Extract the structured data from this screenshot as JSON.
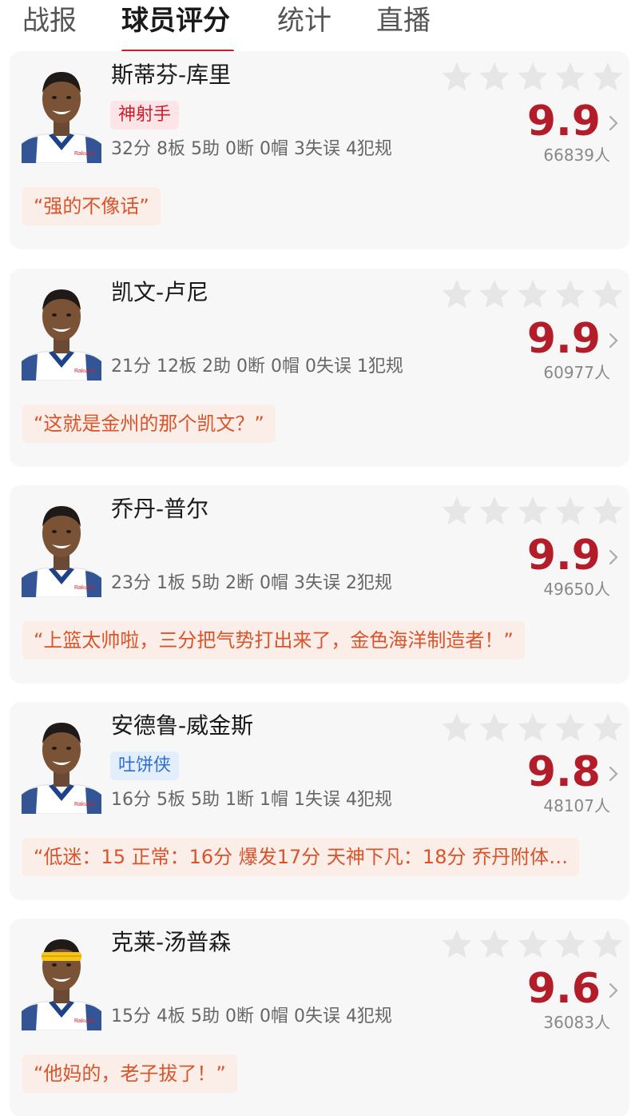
{
  "tabs": [
    {
      "label": "战报"
    },
    {
      "label": "球员评分"
    },
    {
      "label": "统计"
    },
    {
      "label": "直播"
    }
  ],
  "active_tab": "球员评分",
  "colors": {
    "accent": "#c8202d",
    "score": "#b31d2a",
    "quote_text": "#d8542b",
    "quote_bg": "#fbeee9",
    "star_empty": "#e6e6e6"
  },
  "players": [
    {
      "name": "斯蒂芬-库里",
      "badge": "神射手",
      "stats": "32分 8板 5助 0断 0帽 3失误 4犯规",
      "score": "9.9",
      "voters": "66839人",
      "quote": "“强的不像话”",
      "stars_filled": 0,
      "headband": false
    },
    {
      "name": "凯文-卢尼",
      "badge": "",
      "stats": "21分 12板 2助 0断 0帽 0失误 1犯规",
      "score": "9.9",
      "voters": "60977人",
      "quote": "“这就是金州的那个凯文？”",
      "stars_filled": 0,
      "headband": false
    },
    {
      "name": "乔丹-普尔",
      "badge": "",
      "stats": "23分 1板 5助 2断 0帽 3失误 2犯规",
      "score": "9.9",
      "voters": "49650人",
      "quote": "“上篮太帅啦，三分把气势打出来了，金色海洋制造者！”",
      "stars_filled": 0,
      "headband": false
    },
    {
      "name": "安德鲁-威金斯",
      "badge": "吐饼侠",
      "stats": "16分 5板 5助 1断 1帽 1失误 4犯规",
      "score": "9.8",
      "voters": "48107人",
      "quote": "“低迷：15 正常：16分 爆发17分 天神下凡：18分 乔丹附体…",
      "stars_filled": 0,
      "headband": false
    },
    {
      "name": "克莱-汤普森",
      "badge": "",
      "stats": "15分 4板 5助 0断 0帽 0失误 4犯规",
      "score": "9.6",
      "voters": "36083人",
      "quote": "“他妈的，老子拔了！”",
      "stars_filled": 0,
      "headband": true
    }
  ]
}
